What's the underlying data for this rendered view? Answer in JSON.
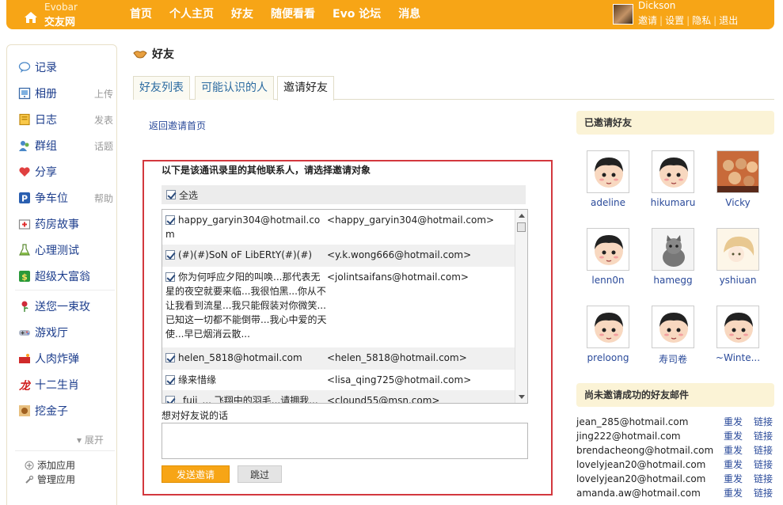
{
  "brand": {
    "en": "Evobar",
    "cn": "交友网"
  },
  "nav": [
    "首页",
    "个人主页",
    "好友",
    "随便看看",
    "Evo 论坛",
    "消息"
  ],
  "user": {
    "name": "Dickson",
    "links": [
      "邀请",
      "设置",
      "隐私",
      "退出"
    ]
  },
  "sidebar": {
    "items": [
      {
        "icon": "speech-bubble-icon",
        "label": "记录",
        "sub": ""
      },
      {
        "icon": "photo-album-icon",
        "label": "相册",
        "sub": "上传"
      },
      {
        "icon": "diary-icon",
        "label": "日志",
        "sub": "发表"
      },
      {
        "icon": "group-icon",
        "label": "群组",
        "sub": "话题"
      },
      {
        "icon": "heart-icon",
        "label": "分享",
        "sub": ""
      },
      {
        "icon": "parking-icon",
        "label": "争车位",
        "sub": "帮助"
      },
      {
        "icon": "medicine-box-icon",
        "label": "药房故事",
        "sub": ""
      },
      {
        "icon": "flask-icon",
        "label": "心理测试",
        "sub": ""
      },
      {
        "icon": "dollar-icon",
        "label": "超级大富翁",
        "sub": ""
      },
      {
        "icon": "rose-icon",
        "label": "送您一束玫",
        "sub": ""
      },
      {
        "icon": "game-icon",
        "label": "游戏厅",
        "sub": ""
      },
      {
        "icon": "bomb-icon",
        "label": "人肉炸弹",
        "sub": ""
      },
      {
        "icon": "dragon-icon",
        "label": "十二生肖",
        "sub": ""
      },
      {
        "icon": "gold-icon",
        "label": "挖金子",
        "sub": ""
      }
    ],
    "expand": "展开",
    "add_app": "添加应用",
    "manage_app": "管理应用"
  },
  "page": {
    "title": "好友",
    "tabs": [
      "好友列表",
      "可能认识的人",
      "邀请好友"
    ],
    "active_tab": 2,
    "back_link": "返回邀请首页"
  },
  "invite": {
    "heading": "以下是该通讯录里的其他联系人，请选择邀请对象",
    "select_all": "全选",
    "contacts": [
      {
        "name": "happy_garyin304@hotmail.com",
        "email": "<happy_garyin304@hotmail.com>"
      },
      {
        "name": "(#)(#)SoN oF LibERtY(#)(#)",
        "email": "<y.k.wong666@hotmail.com>"
      },
      {
        "name": "你为何呼应夕阳的叫唤...那代表无星的夜空就要来临...我很怕黑...你从不让我看到流星...我只能假装对你微笑...已知这一切都不能倒带...我心中爱的天使...早已烟消云散...",
        "email": "<jolintsaifans@hotmail.com>"
      },
      {
        "name": "helen_5818@hotmail.com",
        "email": "<helen_5818@hotmail.com>"
      },
      {
        "name": "缘来惜缘",
        "email": "<lisa_qing725@hotmail.com>"
      },
      {
        "name": "_fuji_... 飞翔中的羽毛...请拥我...",
        "email": "<clound55@msn.com>"
      }
    ],
    "message_label": "想对好友说的话",
    "send_button": "发送邀请",
    "skip_button": "跳过"
  },
  "invited": {
    "heading": "已邀请好友",
    "friends": [
      "adeline",
      "hikumaru",
      "Vicky",
      "lenn0n",
      "hamegg",
      "yshiuan",
      "preloong",
      "寿司卷",
      "~Winte..."
    ]
  },
  "pending": {
    "heading": "尚未邀请成功的好友邮件",
    "resend": "重发",
    "link": "链接",
    "emails": [
      "jean_285@hotmail.com",
      "jing222@hotmail.com",
      "brendacheong@hotmail.com",
      "lovelyjean20@hotmail.com",
      "lovelyjean20@hotmail.com",
      "amanda.aw@hotmail.com"
    ]
  }
}
